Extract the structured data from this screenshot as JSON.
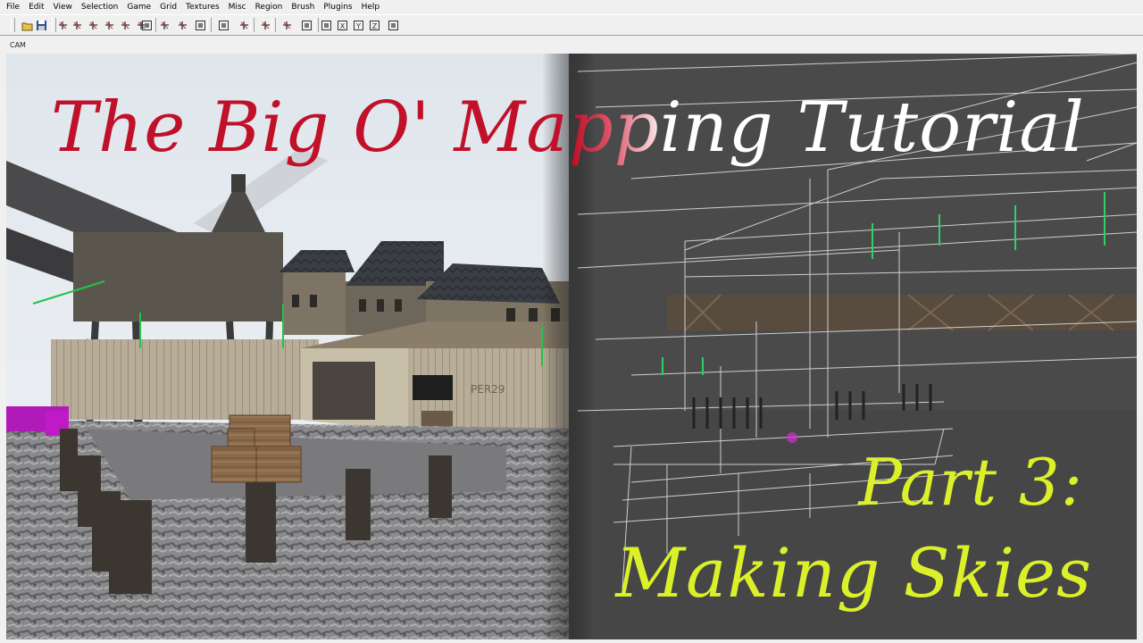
{
  "menu": [
    "File",
    "Edit",
    "View",
    "Selection",
    "Game",
    "Grid",
    "Textures",
    "Misc",
    "Region",
    "Brush",
    "Plugins",
    "Help"
  ],
  "toolbar": {
    "buttons": [
      {
        "icon": "open-folder-icon"
      },
      {
        "icon": "save-icon"
      },
      {
        "icon": "flip-x-icon"
      },
      {
        "icon": "flip-y-icon"
      },
      {
        "icon": "flip-z-icon"
      },
      {
        "icon": "rotate-x-icon"
      },
      {
        "icon": "rotate-y-icon"
      },
      {
        "icon": "rotate-z-icon"
      },
      {
        "icon": "select-complete-tall-icon"
      },
      {
        "icon": "select-touching-icon"
      },
      {
        "icon": "select-partial-icon"
      },
      {
        "icon": "csg-subtract-icon"
      },
      {
        "icon": "csg-merge-icon"
      },
      {
        "icon": "hollow-icon"
      },
      {
        "icon": "clipper-icon"
      },
      {
        "icon": "change-view-icon"
      },
      {
        "icon": "texture-view-icon"
      },
      {
        "icon": "cubic-clip-icon"
      },
      {
        "icon": "camera-x-icon"
      },
      {
        "icon": "camera-y-icon"
      },
      {
        "icon": "camera-z-icon"
      },
      {
        "icon": "entity-list-icon"
      }
    ]
  },
  "camera": {
    "label": "CAM"
  },
  "overlay": {
    "title": "The Big O' Mapping Tutorial",
    "part": "Part 3:",
    "subtitle": "Making Skies",
    "title_color": "#c0102a",
    "accent_color": "#dcf02a",
    "sign_text": "PER29"
  }
}
